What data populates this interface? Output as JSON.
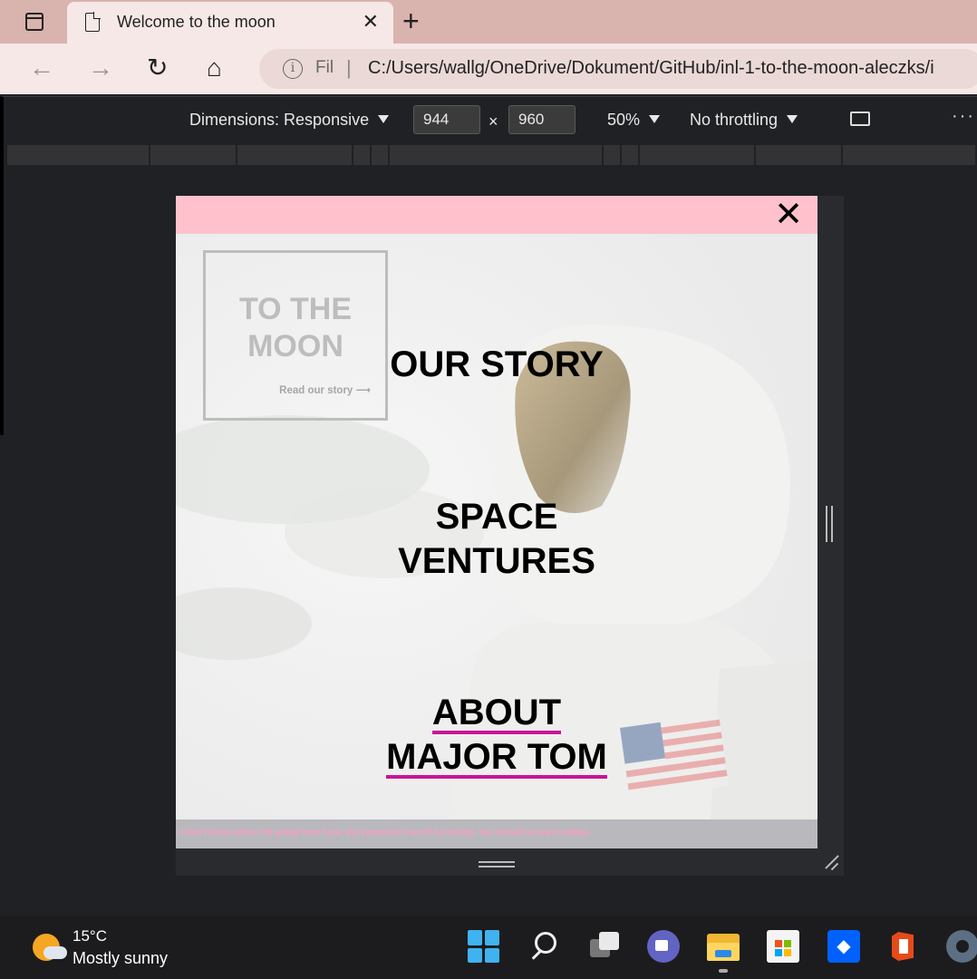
{
  "browser": {
    "tab_title": "Welcome to the moon",
    "tab_close": "✕",
    "new_tab": "+",
    "nav": {
      "back": "←",
      "forward": "→",
      "reload": "↻",
      "home": "⌂"
    },
    "address": {
      "info": "i",
      "scheme": "Fil",
      "separator": "|",
      "url": "C:/Users/wallg/OneDrive/Dokument/GitHub/inl-1-to-the-moon-aleczks/i"
    }
  },
  "devtools": {
    "dimensions_label": "Dimensions: Responsive",
    "width": "944",
    "times": "×",
    "height": "960",
    "zoom": "50%",
    "throttling": "No throttling",
    "more": "···"
  },
  "page": {
    "close_label": "✕",
    "logo_title_line1": "TO THE",
    "logo_title_line2": "MOON",
    "logo_link": "Read our story ⟶",
    "menu": {
      "our_story": "OUR STORY",
      "space_line1": "SPACE",
      "space_line2": "VENTURES",
      "about_line1": "ABOUT",
      "about_line2": "MAJOR TOM"
    },
    "cookie_text": "I don't know where I'm going from here, but I promise it won't be boring. You should accept cookies.",
    "colors": {
      "topbar": "#ffc2cc",
      "underline": "#c8149a",
      "cookie_text": "#ff9bc1"
    }
  },
  "taskbar": {
    "temperature": "15°C",
    "weather": "Mostly sunny",
    "icons": [
      "start-icon",
      "search-icon",
      "task-view-icon",
      "teams-chat-icon",
      "file-explorer-icon",
      "microsoft-store-icon",
      "dropbox-icon",
      "office-icon",
      "settings-icon"
    ]
  }
}
